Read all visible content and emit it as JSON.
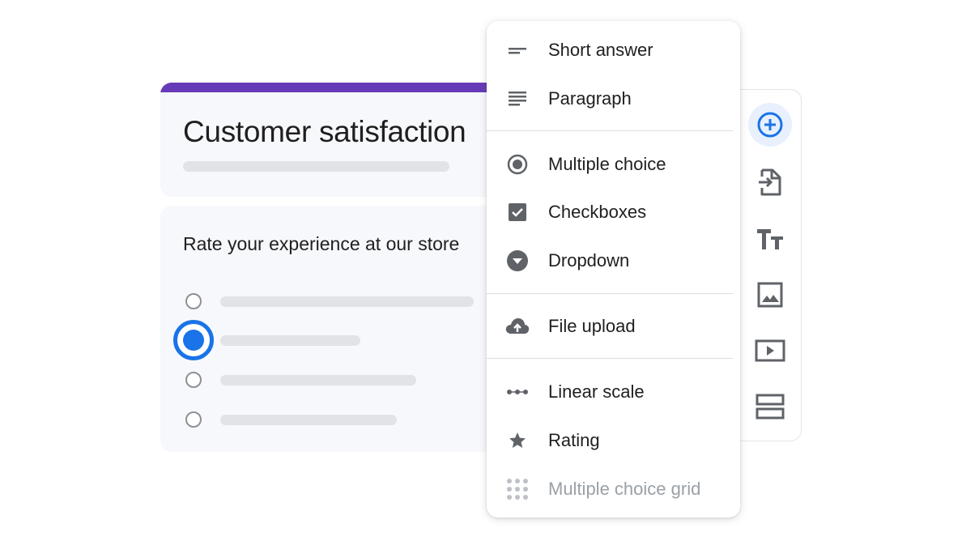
{
  "form": {
    "title": "Customer satisfaction",
    "accent_color": "#673ab7"
  },
  "question": {
    "text": "Rate your experience at our store",
    "selected_option_index": 1
  },
  "menu": {
    "items": [
      {
        "label": "Short answer",
        "icon": "short-answer-icon"
      },
      {
        "label": "Paragraph",
        "icon": "paragraph-icon"
      },
      {
        "label": "Multiple choice",
        "icon": "radio-icon"
      },
      {
        "label": "Checkboxes",
        "icon": "checkbox-icon"
      },
      {
        "label": "Dropdown",
        "icon": "dropdown-icon"
      },
      {
        "label": "File upload",
        "icon": "cloud-upload-icon"
      },
      {
        "label": "Linear scale",
        "icon": "linear-scale-icon"
      },
      {
        "label": "Rating",
        "icon": "star-icon"
      },
      {
        "label": "Multiple choice grid",
        "icon": "grid-icon",
        "disabled": true
      }
    ]
  },
  "toolbar": {
    "items": [
      {
        "icon": "add-circle-icon",
        "active": true
      },
      {
        "icon": "import-questions-icon"
      },
      {
        "icon": "title-text-icon"
      },
      {
        "icon": "image-icon"
      },
      {
        "icon": "video-icon"
      },
      {
        "icon": "section-icon"
      }
    ],
    "accent_color": "#1a73e8"
  }
}
